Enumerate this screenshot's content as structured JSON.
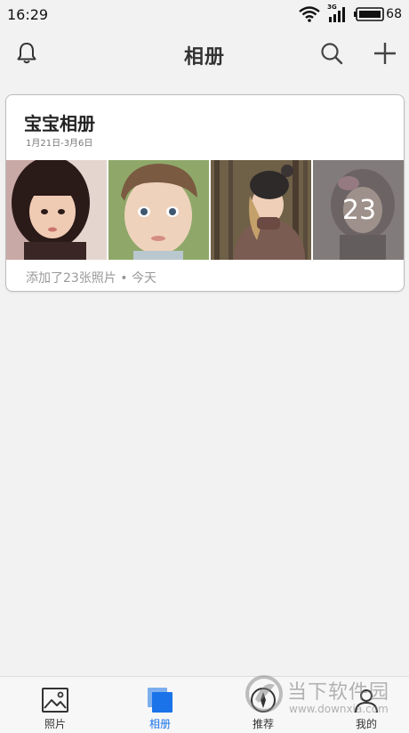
{
  "status_bar": {
    "time": "16:29",
    "network_label": "3G",
    "battery_level": "68"
  },
  "header": {
    "title": "相册",
    "icons": {
      "left": "bell-icon",
      "search": "search-icon",
      "add": "plus-icon"
    }
  },
  "album": {
    "title": "宝宝相册",
    "date_range": "1月21日-3月6日",
    "photo_count_overlay": "23",
    "footer_text": "添加了23张照片 • 今天"
  },
  "tabs": [
    {
      "label": "照片",
      "icon": "image-icon",
      "active": false
    },
    {
      "label": "相册",
      "icon": "albums-icon",
      "active": true
    },
    {
      "label": "推荐",
      "icon": "compass-icon",
      "active": false
    },
    {
      "label": "我的",
      "icon": "person-icon",
      "active": false
    }
  ],
  "watermark": {
    "brand": "当下软件园",
    "url": "www.downxia.com"
  },
  "colors": {
    "accent": "#1a73e8",
    "background": "#f2f2f2",
    "card": "#ffffff"
  }
}
